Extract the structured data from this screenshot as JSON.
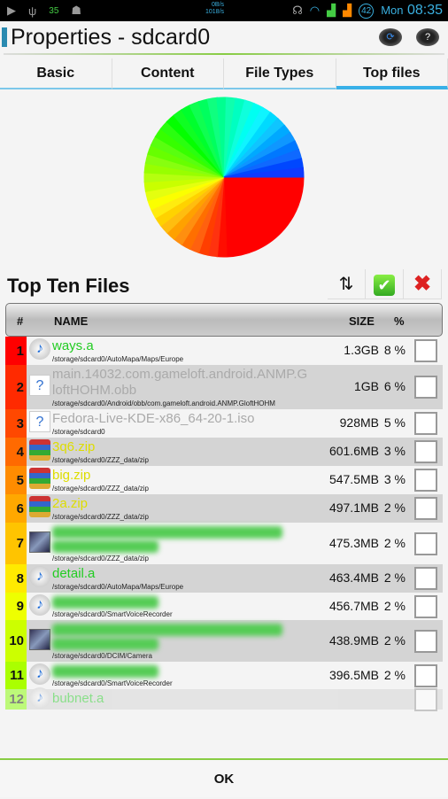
{
  "status_bar": {
    "battery_temp": "35",
    "net_up": "0B/s",
    "net_down": "1018/s",
    "battery": "42",
    "day": "Mon",
    "time": "08:35"
  },
  "titlebar": {
    "title": "Properties - sdcard0",
    "refresh_icon": "refresh-icon",
    "help_label": "?"
  },
  "tabs": [
    {
      "label": "Basic"
    },
    {
      "label": "Content"
    },
    {
      "label": "File Types"
    },
    {
      "label": "Top files",
      "active": true
    }
  ],
  "chart_data": {
    "type": "pie",
    "note_colors": "rainbow gradient from red through yellow, green, cyan to blue"
  },
  "top_files": {
    "title": "Top Ten Files",
    "sort_icon": "sort-arrows-icon",
    "select_all_icon": "check-icon",
    "clear_icon": "close-x-icon",
    "columns": {
      "rank": "#",
      "name": "NAME",
      "size": "SIZE",
      "percent": "%"
    },
    "rows": [
      {
        "rank": "1",
        "icon": "music",
        "color": "green",
        "name": "ways.a",
        "path": "/storage/sdcard0/AutoMapa/Maps/Europe",
        "size": "1.3GB",
        "percent": "8 %",
        "rank_color": "#ff0000"
      },
      {
        "rank": "2",
        "icon": "unk",
        "color": "gray",
        "name": "main.14032.com.gameloft.android.ANMP.GloftHOHM.obb",
        "path": "/storage/sdcard0/Android/obb/com.gameloft.android.ANMP.GloftHOHM",
        "size": "1GB",
        "percent": "6 %",
        "rank_color": "#ff2a00"
      },
      {
        "rank": "3",
        "icon": "unk",
        "color": "gray",
        "name": "Fedora-Live-KDE-x86_64-20-1.iso",
        "path": "/storage/sdcard0",
        "size": "928MB",
        "percent": "5 %",
        "rank_color": "#ff4800"
      },
      {
        "rank": "4",
        "icon": "zip",
        "color": "yellow",
        "name": "3q6.zip",
        "path": "/storage/sdcard0/ZZZ_data/zip",
        "size": "601.6MB",
        "percent": "3 %",
        "rank_color": "#ff6a00"
      },
      {
        "rank": "5",
        "icon": "zip",
        "color": "yellow",
        "name": "big.zip",
        "path": "/storage/sdcard0/ZZZ_data/zip",
        "size": "547.5MB",
        "percent": "3 %",
        "rank_color": "#ff8c00"
      },
      {
        "rank": "6",
        "icon": "zip",
        "color": "yellow",
        "name": "2a.zip",
        "path": "/storage/sdcard0/ZZZ_data/zip",
        "size": "497.1MB",
        "percent": "2 %",
        "rank_color": "#ffa800"
      },
      {
        "rank": "7",
        "icon": "vid",
        "color": "green",
        "name": "",
        "blurred_lines": 2,
        "path": "/storage/sdcard0/ZZZ_data/zip",
        "size": "475.3MB",
        "percent": "2 %",
        "rank_color": "#ffc400"
      },
      {
        "rank": "8",
        "icon": "music",
        "color": "green",
        "name": "detail.a",
        "path": "/storage/sdcard0/AutoMapa/Maps/Europe",
        "size": "463.4MB",
        "percent": "2 %",
        "rank_color": "#ffea00"
      },
      {
        "rank": "9",
        "icon": "music",
        "color": "green",
        "name": "",
        "blurred_lines": 1,
        "path": "/storage/sdcard0/SmartVoiceRecorder",
        "size": "456.7MB",
        "percent": "2 %",
        "rank_color": "#eeff00"
      },
      {
        "rank": "10",
        "icon": "vid",
        "color": "green",
        "name": "",
        "blurred_lines": 2,
        "path": "/storage/sdcard0/DCIM/Camera",
        "size": "438.9MB",
        "percent": "2 %",
        "rank_color": "#ccff00"
      },
      {
        "rank": "11",
        "icon": "music",
        "color": "green",
        "name": "",
        "blurred_lines": 1,
        "path": "/storage/sdcard0/SmartVoiceRecorder",
        "size": "396.5MB",
        "percent": "2 %",
        "rank_color": "#aaff00"
      },
      {
        "rank": "12",
        "icon": "music",
        "color": "green",
        "name": "bubnet.a",
        "path": "",
        "size": "",
        "percent": "",
        "rank_color": "#88ff00"
      }
    ]
  },
  "footer": {
    "ok_label": "OK"
  }
}
